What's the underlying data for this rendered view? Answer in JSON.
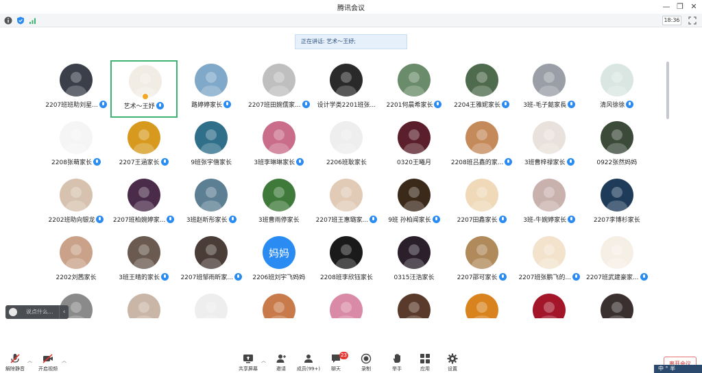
{
  "window": {
    "title": "腾讯会议"
  },
  "infobar": {
    "time": "18:36"
  },
  "speaking_banner": "正在讲话: 艺术～王妤;",
  "colors": {
    "accent": "#2a8bf2",
    "active_border": "#3cb371",
    "danger": "#d32f2f"
  },
  "participants": [
    {
      "name": "2207班班助刘星...",
      "mic": true,
      "color": "#3a3f4a",
      "icon": "anime-boy-avatar"
    },
    {
      "name": "艺术～王妤",
      "mic": true,
      "active": true,
      "host": true,
      "color": "#f1ece4",
      "icon": "anime-couple-avatar"
    },
    {
      "name": "路婷婷家长",
      "mic": true,
      "color": "#7fa8c9",
      "icon": "beach-avatar"
    },
    {
      "name": "2207班田婉儒家...",
      "mic": true,
      "color": "#bfbfbf",
      "icon": "girl-sketch-avatar"
    },
    {
      "name": "设计学类2201班张...",
      "mic": false,
      "color": "#2a2a2a",
      "icon": "couple-photo-avatar"
    },
    {
      "name": "2201何晨希家长",
      "mic": true,
      "color": "#6b8c6a",
      "icon": "girl-outdoor-avatar"
    },
    {
      "name": "2204王雅妮家长",
      "mic": true,
      "color": "#4f6b4d",
      "icon": "garden-avatar"
    },
    {
      "name": "3班-毛子懿家長",
      "mic": true,
      "color": "#9a9ea6",
      "icon": "figures-avatar"
    },
    {
      "name": "清风徐徐",
      "mic": true,
      "color": "#d9e6e1",
      "icon": "flower-art-avatar"
    },
    {
      "name": "2208张萌家长",
      "mic": true,
      "color": "#f5f5f5",
      "icon": "line-art-avatar"
    },
    {
      "name": "2207王涵家长",
      "mic": true,
      "color": "#d79a1e",
      "icon": "sunflower-avatar"
    },
    {
      "name": "9班张宇僖家长",
      "mic": false,
      "color": "#2f6f8a",
      "icon": "waterfall-avatar"
    },
    {
      "name": "3班李琳琳家长",
      "mic": true,
      "color": "#c96d8a",
      "icon": "cartoon-avatar"
    },
    {
      "name": "2206班耿家长",
      "mic": false,
      "color": "#eeeeee",
      "icon": "manga-avatar"
    },
    {
      "name": "0320王曦月",
      "mic": false,
      "color": "#5a1f2a",
      "icon": "roses-avatar"
    },
    {
      "name": "2208班吕鑫的家...",
      "mic": true,
      "color": "#c58a5a",
      "icon": "bear-avatar"
    },
    {
      "name": "3班曹梓禄家长",
      "mic": true,
      "color": "#e9e2dc",
      "icon": "portrait-avatar"
    },
    {
      "name": "0922张然妈妈",
      "mic": false,
      "color": "#3c4a3a",
      "icon": "vase-avatar"
    },
    {
      "name": "2202班助向银龙",
      "mic": true,
      "color": "#d6c2ae",
      "icon": "child-avatar"
    },
    {
      "name": "2207班柏婉婷家...",
      "mic": true,
      "color": "#4a2b4a",
      "icon": "doll-avatar"
    },
    {
      "name": "3班赵昕彤家长",
      "mic": true,
      "color": "#5d7f93",
      "icon": "sea-avatar"
    },
    {
      "name": "3班曹雨停家长",
      "mic": false,
      "color": "#3f7a3a",
      "icon": "strawberry-avatar"
    },
    {
      "name": "2207班王惠璐家...",
      "mic": true,
      "color": "#e1cbb6",
      "icon": "girl-photo-avatar"
    },
    {
      "name": "9班 孙柏闻家长",
      "mic": true,
      "color": "#3b2a1a",
      "icon": "night-street-avatar"
    },
    {
      "name": "2207田鑫家长",
      "mic": true,
      "color": "#f0d9b8",
      "icon": "dog-avatar"
    },
    {
      "name": "3班-牛婉婷家长",
      "mic": true,
      "color": "#c9b2ad",
      "icon": "cat-avatar"
    },
    {
      "name": "2207李博杉家长",
      "mic": false,
      "color": "#1e3c5a",
      "icon": "starry-avatar"
    },
    {
      "name": "2202刘茜家长",
      "mic": false,
      "color": "#caa28a",
      "icon": "kid-avatar"
    },
    {
      "name": "3班王晴的家长",
      "mic": true,
      "color": "#6a5a50",
      "icon": "boy-photo-avatar"
    },
    {
      "name": "2207班邹雨昕家...",
      "mic": true,
      "color": "#4a3c36",
      "icon": "silhouette-avatar"
    },
    {
      "name": "2206班刘宇飞妈妈",
      "mic": false,
      "color": "#2a8bf2",
      "icon": "text-avatar",
      "avatar_text": "妈妈"
    },
    {
      "name": "2208班李欣钰家长",
      "mic": false,
      "color": "#1a1a1a",
      "icon": "dark-portrait-avatar"
    },
    {
      "name": "0315汪浩家长",
      "mic": false,
      "color": "#2a1f2a",
      "icon": "anime-girl-avatar"
    },
    {
      "name": "2207邵可家长",
      "mic": true,
      "color": "#b08a5a",
      "icon": "room-avatar"
    },
    {
      "name": "2207班张鹏飞的...",
      "mic": true,
      "color": "#f3e3cc",
      "icon": "girl-hat-avatar"
    },
    {
      "name": "2207班武建豪家...",
      "mic": true,
      "color": "#f6efe6",
      "icon": "pet-cartoon-avatar"
    },
    {
      "name": "",
      "mic": false,
      "color": "#8a8a8a",
      "icon": "gray-avatar"
    },
    {
      "name": "",
      "mic": false,
      "color": "#c9b6a6",
      "icon": "girl-face-avatar"
    },
    {
      "name": "",
      "mic": false,
      "color": "#eeeeee",
      "icon": "sketch-avatar"
    },
    {
      "name": "",
      "mic": false,
      "color": "#c87a4a",
      "icon": "colorful-avatar"
    },
    {
      "name": "",
      "mic": false,
      "color": "#d98aa6",
      "icon": "pink-avatar"
    },
    {
      "name": "",
      "mic": false,
      "color": "#5a3a2a",
      "icon": "room2-avatar"
    },
    {
      "name": "",
      "mic": false,
      "color": "#d9831e",
      "icon": "candle-avatar"
    },
    {
      "name": "",
      "mic": false,
      "color": "#a3162a",
      "icon": "red-flower-avatar"
    },
    {
      "name": "",
      "mic": false,
      "color": "#3a3030",
      "icon": "woman-avatar"
    }
  ],
  "chat": {
    "placeholder": "说点什么..."
  },
  "toolbar": {
    "unmute": "解除静音",
    "video": "开启视频",
    "share": "共享屏幕",
    "invite": "邀请",
    "members": "成员(99+)",
    "chat": "聊天",
    "chat_badge": "23",
    "record": "录制",
    "raise_hand": "举手",
    "apps": "应用",
    "settings": "设置",
    "leave": "离开会议"
  },
  "ime": "中 ° 半"
}
